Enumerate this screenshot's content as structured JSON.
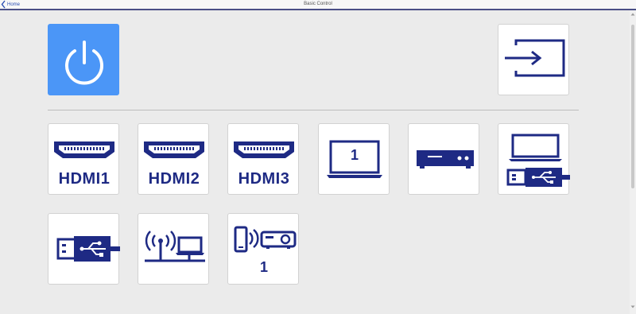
{
  "header": {
    "back_label": "Home",
    "title": "Basic Control"
  },
  "top_controls": [
    {
      "name": "power",
      "icon": "power-icon",
      "color": "#4b96f7"
    },
    {
      "name": "source-switch",
      "icon": "input-source-icon"
    }
  ],
  "sources": [
    {
      "label": "HDMI1",
      "icon": "hdmi-port-icon"
    },
    {
      "label": "HDMI2",
      "icon": "hdmi-port-icon"
    },
    {
      "label": "HDMI3",
      "icon": "hdmi-port-icon"
    },
    {
      "label": "1",
      "icon": "computer-icon"
    },
    {
      "label": "",
      "icon": "video-player-icon"
    },
    {
      "label": "",
      "icon": "usb-display-icon"
    },
    {
      "label": "",
      "icon": "usb-icon"
    },
    {
      "label": "",
      "icon": "network-icon"
    },
    {
      "label": "1",
      "icon": "screen-mirroring-icon"
    }
  ],
  "colors": {
    "icon": "#1e2a84",
    "accent": "#4b96f7",
    "link": "#2c4fb3",
    "background": "#ebebeb"
  }
}
